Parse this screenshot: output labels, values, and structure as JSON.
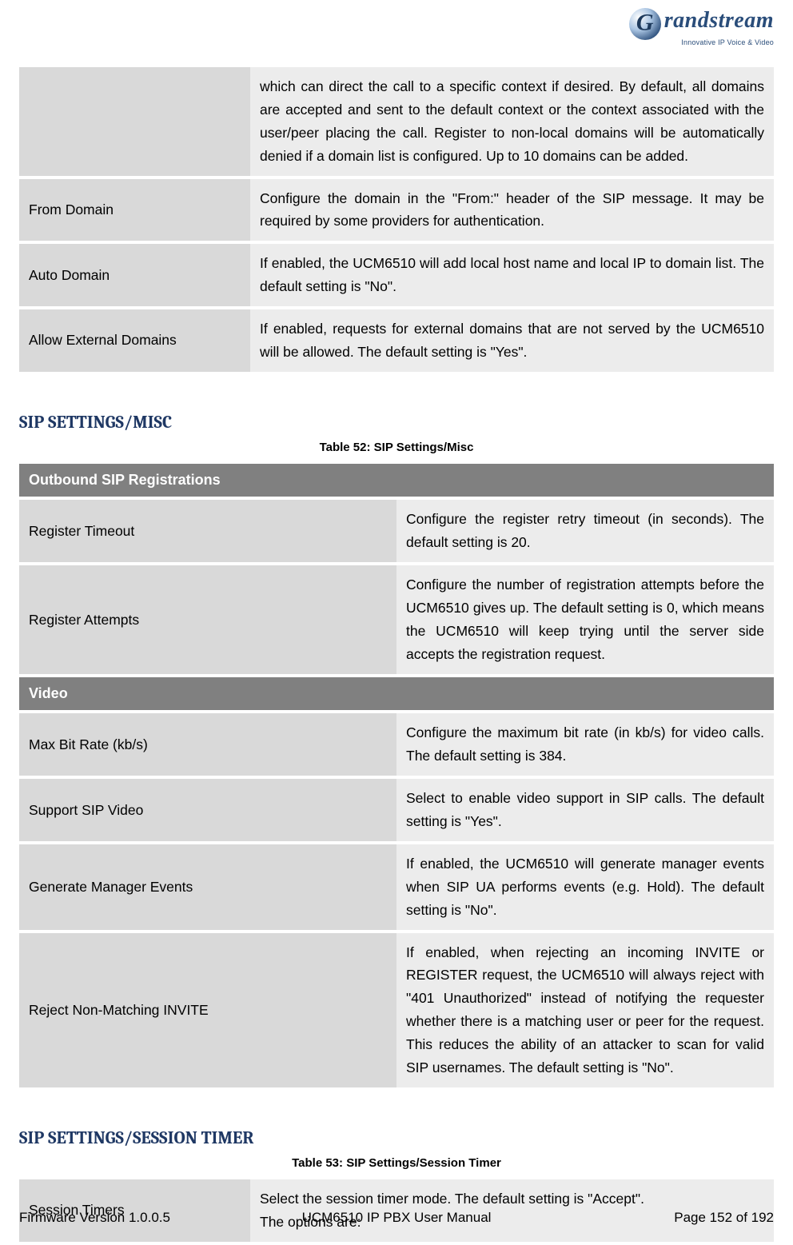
{
  "logo": {
    "brand": "randstream",
    "tagline": "Innovative IP Voice & Video"
  },
  "tables": {
    "top": [
      {
        "label": "",
        "desc": "which can direct the call to a specific context if desired. By default, all domains are accepted and sent to the default context or the context associated with the user/peer placing the call. Register to non-local domains will be automatically denied if a domain list is configured. Up to 10 domains can be added."
      },
      {
        "label": "From Domain",
        "desc": "Configure the domain in the \"From:\" header of the SIP message. It may be required by some providers for authentication."
      },
      {
        "label": "Auto Domain",
        "desc": "If enabled, the UCM6510 will add local host name and local IP to domain list. The default setting is \"No\"."
      },
      {
        "label": "Allow External Domains",
        "desc": "If enabled, requests for external domains that are not served by the UCM6510 will be allowed. The default setting is \"Yes\"."
      }
    ]
  },
  "misc": {
    "heading": "SIP SETTINGS/MISC",
    "caption": "Table 52: SIP Settings/Misc",
    "section1": "Outbound SIP Registrations",
    "rows1": [
      {
        "label": "Register Timeout",
        "desc": "Configure the register retry timeout (in seconds). The default setting is 20."
      },
      {
        "label": "Register Attempts",
        "desc": "Configure the number of registration attempts before the UCM6510 gives up. The default setting is 0, which means the UCM6510 will keep trying until the server side accepts the registration request."
      }
    ],
    "section2": "Video",
    "rows2": [
      {
        "label": "Max Bit Rate (kb/s)",
        "desc": "Configure the maximum bit rate (in kb/s) for video calls. The default setting is 384."
      },
      {
        "label": "Support SIP Video",
        "desc": "Select to enable video support in SIP calls. The default setting is \"Yes\"."
      },
      {
        "label": "Generate Manager Events",
        "desc": "If enabled, the UCM6510 will generate manager events when SIP UA performs events (e.g. Hold). The default setting is \"No\"."
      },
      {
        "label": "Reject Non-Matching INVITE",
        "desc": "If enabled, when rejecting an incoming INVITE or REGISTER request, the UCM6510 will always reject with \"401 Unauthorized\" instead of notifying the requester whether there is a matching user or peer for the request. This reduces the ability of an attacker to scan for valid SIP usernames. The default setting is \"No\"."
      }
    ]
  },
  "session": {
    "heading": "SIP SETTINGS/SESSION TIMER",
    "caption": "Table 53: SIP Settings/Session Timer",
    "rows": [
      {
        "label": "Session Timers",
        "desc": "Select the session timer mode. The default setting is \"Accept\".\nThe options are:"
      }
    ]
  },
  "footer": {
    "left": "Firmware Version 1.0.0.5",
    "center": "UCM6510 IP PBX User Manual",
    "right": "Page 152 of 192"
  }
}
